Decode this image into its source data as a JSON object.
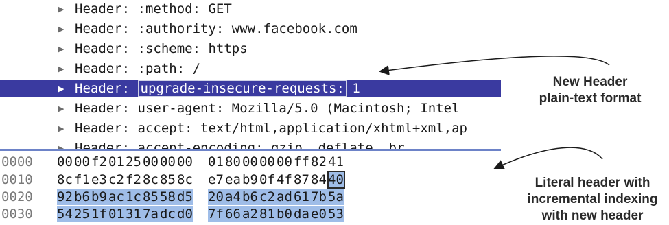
{
  "tree_rows": [
    {
      "text": "Header: :method: GET"
    },
    {
      "text": "Header: :authority: www.facebook.com"
    },
    {
      "text": "Header: :scheme: https"
    },
    {
      "text": "Header: :path: /"
    },
    {
      "prefix": "Header: ",
      "highlight": "upgrade-insecure-requests:",
      "suffix": " 1"
    },
    {
      "text": "Header: user-agent: Mozilla/5.0 (Macintosh; Intel"
    },
    {
      "text": "Header: accept: text/html,application/xhtml+xml,ap"
    },
    {
      "text": "Header: accept-encoding: gzip, deflate, br"
    }
  ],
  "hex_rows": [
    {
      "offset": "0000",
      "bytes": [
        "00",
        "00",
        "f2",
        "01",
        "25",
        "00",
        "00",
        "00",
        "01",
        "80",
        "00",
        "00",
        "00",
        "ff",
        "82",
        "41"
      ]
    },
    {
      "offset": "0010",
      "bytes": [
        "8c",
        "f1",
        "e3",
        "c2",
        "f2",
        "8c",
        "85",
        "8c",
        "e7",
        "ea",
        "b9",
        "0f",
        "4f",
        "87",
        "84",
        "40"
      ]
    },
    {
      "offset": "0020",
      "bytes": [
        "92",
        "b6",
        "b9",
        "ac",
        "1c",
        "85",
        "58",
        "d5",
        "20",
        "a4",
        "b6",
        "c2",
        "ad",
        "61",
        "7b",
        "5a"
      ]
    },
    {
      "offset": "0030",
      "bytes": [
        "54",
        "25",
        "1f",
        "01",
        "31",
        "7a",
        "dc",
        "d0",
        "7f",
        "66",
        "a2",
        "81",
        "b0",
        "da",
        "e0",
        "53"
      ]
    }
  ],
  "annotations": {
    "new_header": [
      "New Header",
      "plain-text format"
    ],
    "literal_header": [
      "Literal header with",
      "incremental indexing",
      "with new header"
    ]
  },
  "colors": {
    "selected_row_bg": "#3a3aa0",
    "hex_selection_bg": "#9fbde8",
    "divider": "#6d83c8"
  }
}
